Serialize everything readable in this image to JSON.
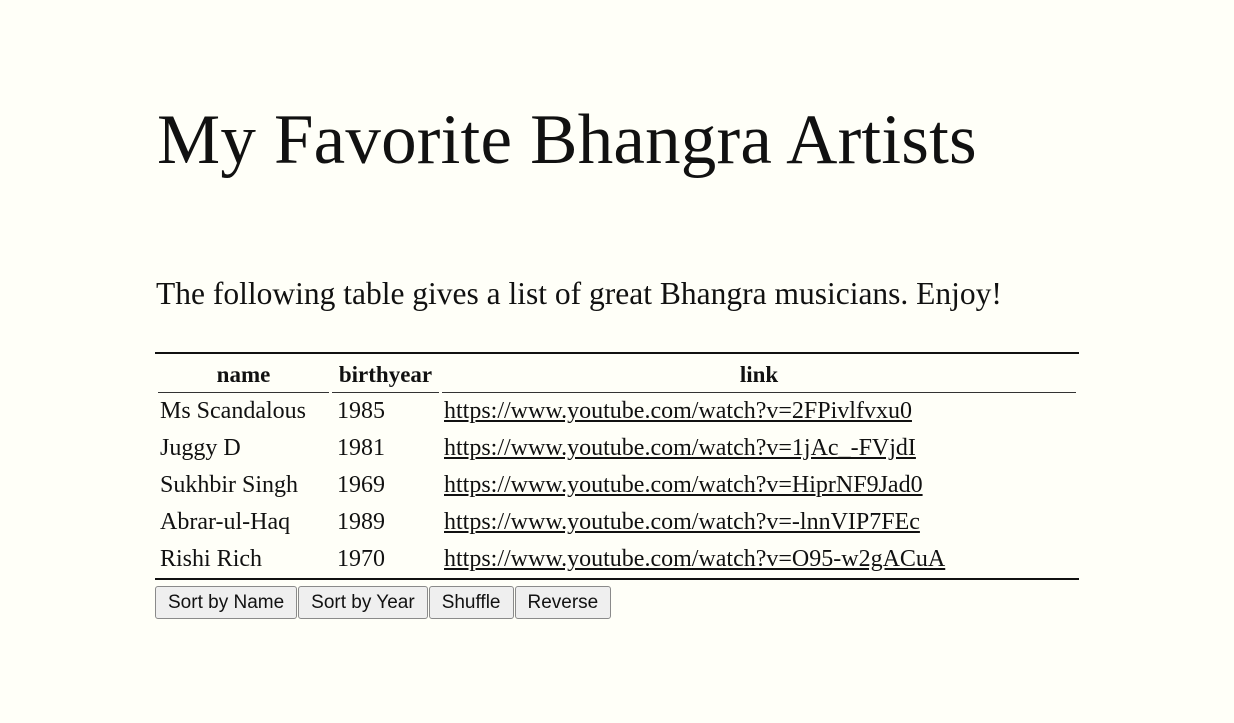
{
  "page": {
    "title": "My Favorite Bhangra Artists",
    "intro": "The following table gives a list of great Bhangra musicians. Enjoy!"
  },
  "table": {
    "headers": [
      "name",
      "birthyear",
      "link"
    ],
    "rows": [
      {
        "name": "Ms Scandalous",
        "birthyear": "1985",
        "link": "https://www.youtube.com/watch?v=2FPivlfvxu0"
      },
      {
        "name": "Juggy D",
        "birthyear": "1981",
        "link": "https://www.youtube.com/watch?v=1jAc_-FVjdI"
      },
      {
        "name": "Sukhbir Singh",
        "birthyear": "1969",
        "link": "https://www.youtube.com/watch?v=HiprNF9Jad0"
      },
      {
        "name": "Abrar-ul-Haq",
        "birthyear": "1989",
        "link": "https://www.youtube.com/watch?v=-lnnVIP7FEc"
      },
      {
        "name": "Rishi Rich",
        "birthyear": "1970",
        "link": "https://www.youtube.com/watch?v=O95-w2gACuA"
      }
    ]
  },
  "buttons": {
    "sort_name": "Sort by Name",
    "sort_year": "Sort by Year",
    "shuffle": "Shuffle",
    "reverse": "Reverse"
  },
  "colors": {
    "background": "#fffff8",
    "text": "#111111",
    "button_bg": "#efefef"
  }
}
